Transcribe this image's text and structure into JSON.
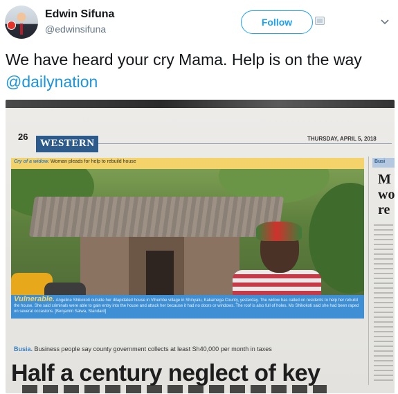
{
  "author": {
    "name": "Edwin Sifuna",
    "handle": "@edwinsifuna"
  },
  "actions": {
    "follow_label": "Follow",
    "follow_icon": "add-user-icon",
    "menu_icon": "chevron-down-icon"
  },
  "tweet": {
    "text": "We have heard your cry Mama. Help is on the way ",
    "mention": "@dailynation"
  },
  "newspaper": {
    "page_number": "26",
    "section": "WESTERN",
    "date": "THURSDAY, APRIL 5, 2018",
    "kicker_label": "Cry of a widow.",
    "kicker_text": "Woman pleads for help to rebuild house",
    "caption_label": "Vulnerable.",
    "caption_text": "Angeline Shikokoti outside her dilapidated house in Vihembe village in Shinyalu, Kakamega County, yesterday. The widow has called on residents to help her rebuild the house. She said criminals were able to gain entry into the house and attack her because it had no doors or windows. The roof is also full of holes. Ms Shikokoti said she had been raped on several occasions. [Benjamin Salwa, Standard]",
    "side_tag": "Busi",
    "side_head": "M\nwo\nre",
    "story_place": "Busia.",
    "story_kicker": "Business people say county government collects at least Sh40,000 per month in taxes",
    "headline": "Half a century neglect of key"
  }
}
